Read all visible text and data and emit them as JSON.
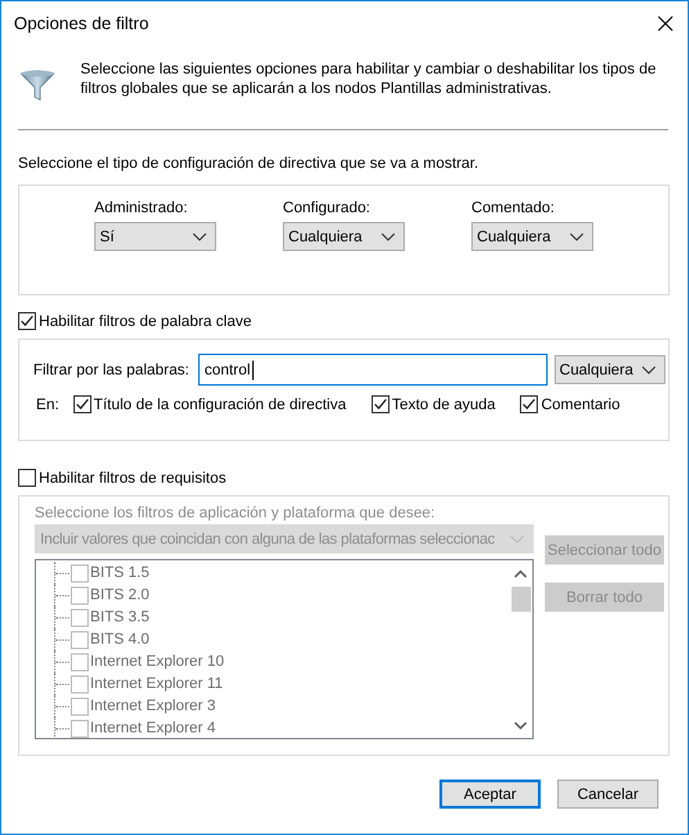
{
  "window": {
    "title": "Opciones de filtro"
  },
  "intro": "Seleccione las siguientes opciones para habilitar y cambiar o deshabilitar los tipos de filtros globales que se aplicarán a los nodos Plantillas administrativas.",
  "display_prompt": "Seleccione el tipo de configuración de directiva que se va a mostrar.",
  "display_fields": [
    {
      "label": "Administrado:",
      "value": "Sí"
    },
    {
      "label": "Configurado:",
      "value": "Cualquiera"
    },
    {
      "label": "Comentado:",
      "value": "Cualquiera"
    }
  ],
  "keyword_filter": {
    "label": "Habilitar filtros de palabra clave",
    "checked": true,
    "filter_label": "Filtrar por las palabras:",
    "value": "control",
    "match": "Cualquiera",
    "in_label": "En:",
    "scopes": [
      {
        "label": "Título de la configuración de directiva",
        "checked": true
      },
      {
        "label": "Texto de ayuda",
        "checked": true
      },
      {
        "label": "Comentario",
        "checked": true
      }
    ]
  },
  "requirements_filter": {
    "label": "Habilitar filtros de requisitos",
    "checked": false,
    "prompt": "Seleccione los filtros de aplicación y plataforma que desee:",
    "mode": "Incluir valores que coincidan con alguna de las plataformas seleccionac",
    "platforms": [
      {
        "label": "BITS 1.5",
        "checked": false
      },
      {
        "label": "BITS 2.0",
        "checked": false
      },
      {
        "label": "BITS 3.5",
        "checked": false
      },
      {
        "label": "BITS 4.0",
        "checked": false
      },
      {
        "label": "Internet Explorer 10",
        "checked": false
      },
      {
        "label": "Internet Explorer 11",
        "checked": false
      },
      {
        "label": "Internet Explorer 3",
        "checked": false
      },
      {
        "label": "Internet Explorer 4",
        "checked": false
      }
    ],
    "buttons": [
      "Seleccionar todo",
      "Borrar todo"
    ]
  },
  "buttons": [
    {
      "label": "Aceptar",
      "default": true
    },
    {
      "label": "Cancelar",
      "default": false
    }
  ]
}
